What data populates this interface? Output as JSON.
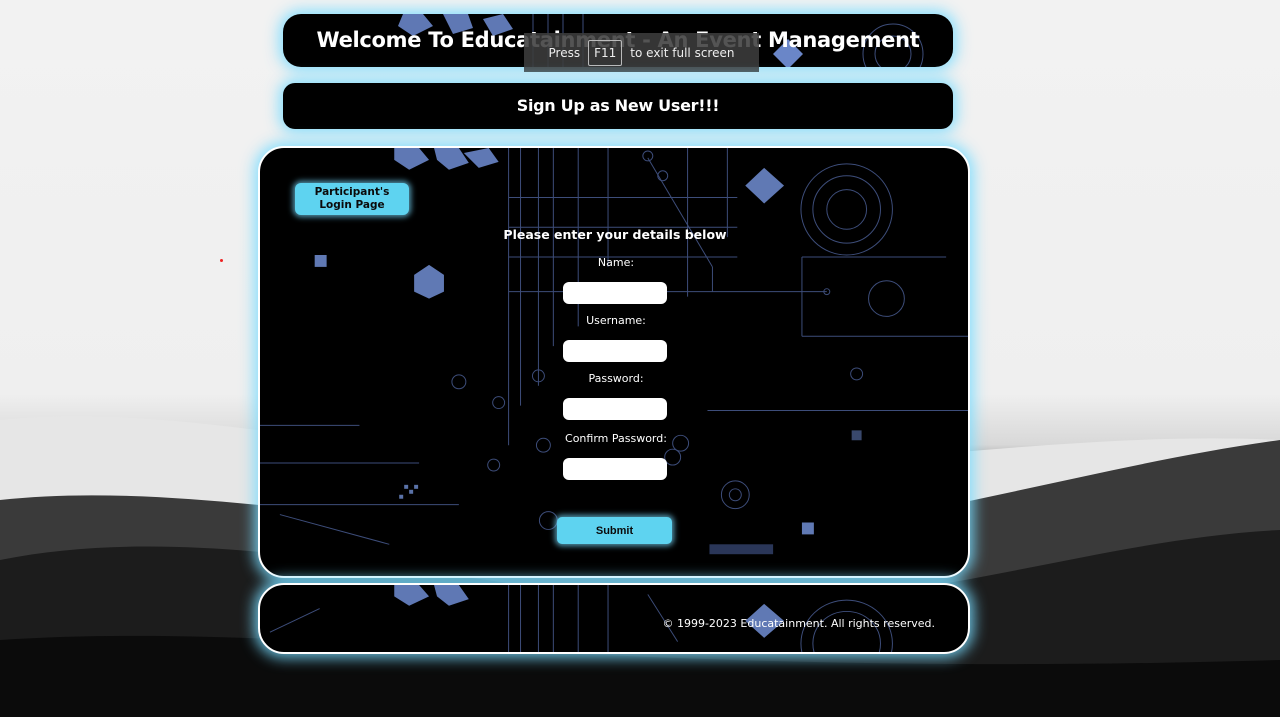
{
  "header": {
    "title": "Welcome To Educatainment - An Event Management Portal!"
  },
  "subheader": {
    "title": "Sign Up as New User!!!"
  },
  "main": {
    "login_button": "Participant's Login Page",
    "form_title": "Please enter your details below",
    "fields": [
      {
        "label": "Name:",
        "value": ""
      },
      {
        "label": "Username:",
        "value": ""
      },
      {
        "label": "Password:",
        "value": ""
      },
      {
        "label": "Confirm Password:",
        "value": ""
      }
    ],
    "submit_label": "Submit"
  },
  "footer": {
    "copyright": "© 1999-2023 Educatainment. All rights reserved."
  },
  "fullscreen_notice": {
    "press": "Press",
    "key": "F11",
    "suffix": "to exit full screen"
  },
  "colors": {
    "accent": "#5ed3f0",
    "glow": "#78dcff",
    "panel": "#000000",
    "tech_blue": "#6a86c8"
  }
}
